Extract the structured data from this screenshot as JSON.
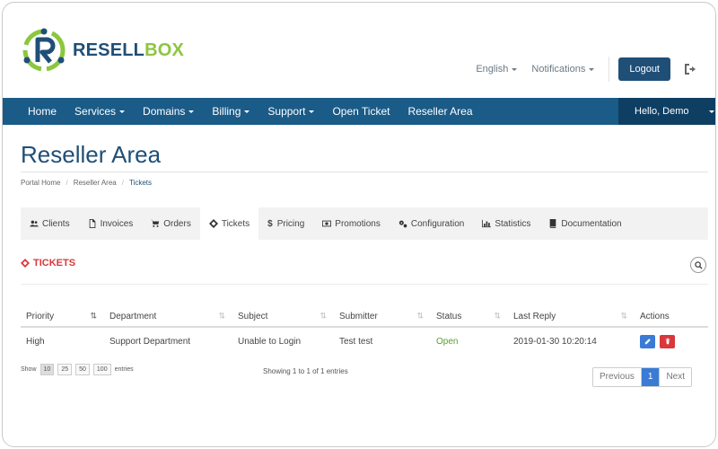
{
  "brand": {
    "name_part1": "RESELL",
    "name_part2": "BOX",
    "colors": {
      "navy": "#1f4f77",
      "green": "#8cc63f"
    }
  },
  "header": {
    "language_label": "English",
    "notifications_label": "Notifications",
    "logout_label": "Logout",
    "signout_icon": "signout-icon"
  },
  "navbar": {
    "items": [
      {
        "label": "Home",
        "dropdown": false
      },
      {
        "label": "Services",
        "dropdown": true
      },
      {
        "label": "Domains",
        "dropdown": true
      },
      {
        "label": "Billing",
        "dropdown": true
      },
      {
        "label": "Support",
        "dropdown": true
      },
      {
        "label": "Open Ticket",
        "dropdown": false
      },
      {
        "label": "Reseller Area",
        "dropdown": false
      }
    ],
    "user_label": "Hello, Demo",
    "color": "#1a5b88",
    "user_bg": "#0e3f63"
  },
  "page": {
    "title": "Reseller Area",
    "breadcrumb": [
      "Portal Home",
      "Reseller Area",
      "Tickets"
    ]
  },
  "tabs": [
    {
      "label": "Clients",
      "icon": "users-icon"
    },
    {
      "label": "Invoices",
      "icon": "file-icon"
    },
    {
      "label": "Orders",
      "icon": "cart-icon"
    },
    {
      "label": "Tickets",
      "icon": "ticket-icon",
      "active": true
    },
    {
      "label": "Pricing",
      "icon": "dollar-icon"
    },
    {
      "label": "Promotions",
      "icon": "money-icon"
    },
    {
      "label": "Configuration",
      "icon": "cogs-icon"
    },
    {
      "label": "Statistics",
      "icon": "bar-chart-icon"
    },
    {
      "label": "Documentation",
      "icon": "book-icon"
    }
  ],
  "section": {
    "title": "TICKETS",
    "accent": "#d9373b"
  },
  "table": {
    "columns": [
      "Priority",
      "Department",
      "Subject",
      "Submitter",
      "Status",
      "Last Reply",
      "Actions"
    ],
    "rows": [
      {
        "priority": "High",
        "department": "Support Department",
        "subject": "Unable to Login",
        "submitter": "Test test",
        "status": "Open",
        "last_reply": "2019-01-30 10:20:14"
      }
    ]
  },
  "footer": {
    "show_label": "Show",
    "page_sizes": [
      "10",
      "25",
      "50",
      "100"
    ],
    "entries_label": "entries",
    "showing_text": "Showing 1 to 1 of 1 entries",
    "pager": {
      "previous": "Previous",
      "current": "1",
      "next": "Next"
    }
  }
}
